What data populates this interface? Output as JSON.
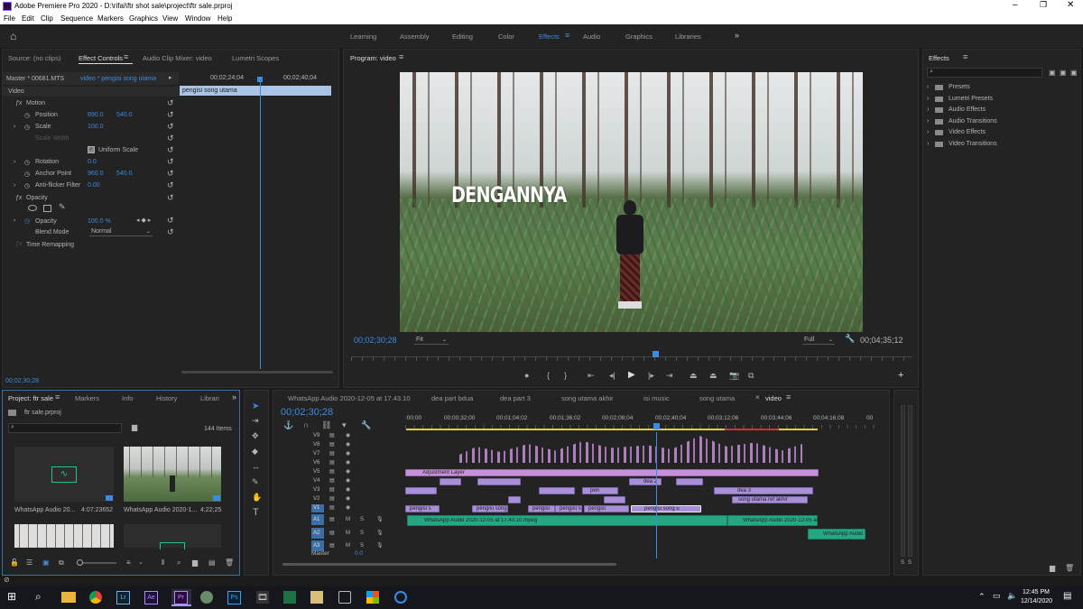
{
  "window": {
    "title": "Adobe Premiere Pro 2020 - D:\\rifai\\ftr shot sale\\project\\ftr sale.prproj"
  },
  "menu": [
    "File",
    "Edit",
    "Clip",
    "Sequence",
    "Markers",
    "Graphics",
    "View",
    "Window",
    "Help"
  ],
  "workspaces": [
    "Learning",
    "Assembly",
    "Editing",
    "Color",
    "Effects",
    "Audio",
    "Graphics",
    "Libraries"
  ],
  "active_workspace": "Effects",
  "source_panel": {
    "tabs": [
      "Source: (no clips)",
      "Effect Controls",
      "Audio Clip Mixer: video",
      "Lumetri Scopes"
    ],
    "master": "Master * 00681.MTS",
    "sequence": "video * pengisi song utama",
    "tc1": "00;02;24;04",
    "tc2": "00;02;40;04",
    "clip_name": "pengisi song utama",
    "section": "Video",
    "motion": "Motion",
    "props": [
      {
        "name": "Position",
        "v1": "890.0",
        "v2": "540.0"
      },
      {
        "name": "Scale",
        "v1": "100.0",
        "v2": ""
      },
      {
        "name": "Scale Width",
        "v1": "",
        "v2": ""
      },
      {
        "name": "Uniform Scale",
        "v1": "",
        "v2": ""
      },
      {
        "name": "Rotation",
        "v1": "0.0",
        "v2": ""
      },
      {
        "name": "Anchor Point",
        "v1": "960.0",
        "v2": "540.0"
      },
      {
        "name": "Anti-flicker Filter",
        "v1": "0.00",
        "v2": ""
      }
    ],
    "opacity": "Opacity",
    "opacity_val": "100.0 %",
    "blend_mode": "Blend Mode",
    "blend_val": "Normal",
    "time_remap": "Time Remapping",
    "bottom_tc": "00;02;30;28"
  },
  "program": {
    "title": "Program: video",
    "overlay_text": "DENGANNYA",
    "tc": "00;02;30;28",
    "fit": "Fit",
    "full": "Full",
    "duration": "00;04;35;12"
  },
  "effects_panel": {
    "title": "Effects",
    "items": [
      "Presets",
      "Lumetri Presets",
      "Audio Effects",
      "Audio Transitions",
      "Video Effects",
      "Video Transitions"
    ]
  },
  "project": {
    "tabs": [
      "Project: ftr sale",
      "Markers",
      "Info",
      "History",
      "Librari"
    ],
    "file": "ftr sale.prproj",
    "count": "144 Items",
    "thumbs": [
      {
        "name": "WhatsApp Audio 20...",
        "dur": "4:07:23652"
      },
      {
        "name": "WhatsApp Audio 2020-1...",
        "dur": "4;22;25"
      }
    ]
  },
  "timeline": {
    "tabs": [
      "WhatsApp Audio 2020-12-05 at 17.43.10",
      "dea part bdua",
      "dea part 3",
      "song utama akhir",
      "isi music",
      "song utama",
      "video"
    ],
    "tc": "00;02;30;28",
    "ruler": [
      ":00;00",
      "00;00;32;00",
      "00;01;04;02",
      "00;01;36;02",
      "00;02;08;04",
      "00;02;40;04",
      "00;03;12;06",
      "00;03;44;06",
      "00;04;16;08",
      "00"
    ],
    "video_tracks": [
      "V9",
      "V8",
      "V7",
      "V6",
      "V5",
      "V4",
      "V3",
      "V2",
      "V1"
    ],
    "audio_tracks": [
      "A1",
      "A2",
      "A3"
    ],
    "master": "Master",
    "master_val": "0.0",
    "clip_labels": {
      "adj": "Adjustment Layer",
      "dea2": "dea 2",
      "dea3": "dea 3",
      "pen": "pen",
      "sura": "song utama ref akhir",
      "p1": "pengisi s",
      "p2": "pengisi song",
      "p3": "pengisi",
      "p4": "pengisi s",
      "p5": "pengisi",
      "p6": "pengisi song u",
      "a1a": "WhatsApp Audio 2020-12-05 at 17.43.10.mpeg",
      "a1b": "WhatsApp Audio 2020-12-05 at",
      "a2": "WhatsApp Audio"
    },
    "meter": [
      "S",
      "S"
    ]
  },
  "taskbar": {
    "time": "12:45 PM",
    "date": "12/14/2020"
  }
}
